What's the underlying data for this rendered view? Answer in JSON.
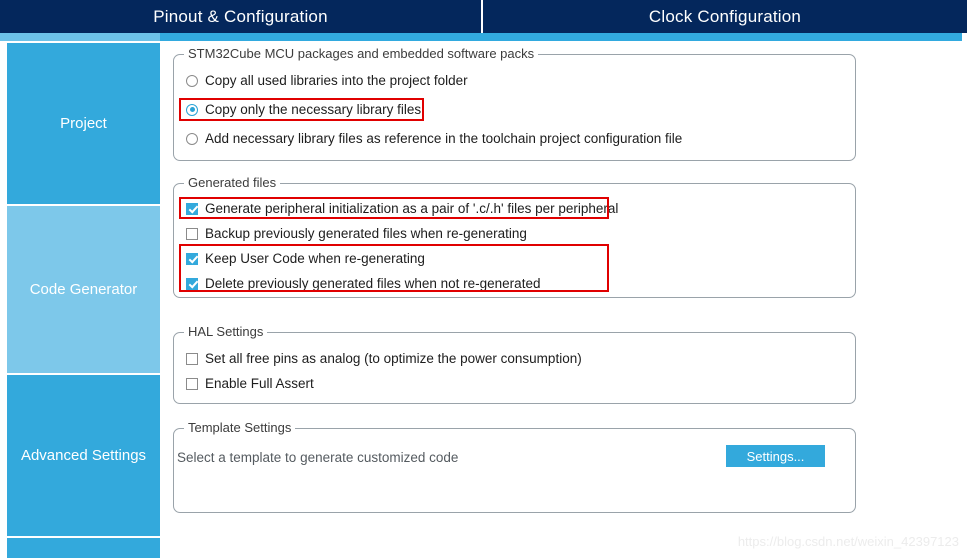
{
  "tabs": [
    {
      "id": "pinout",
      "label": "Pinout & Configuration"
    },
    {
      "id": "clock",
      "label": "Clock Configuration"
    }
  ],
  "sidebar": {
    "items": [
      {
        "id": "project",
        "label": "Project",
        "selected": false
      },
      {
        "id": "code-generator",
        "label": "Code Generator",
        "selected": true
      },
      {
        "id": "advanced-settings",
        "label": "Advanced Settings",
        "selected": false
      }
    ]
  },
  "groups": {
    "packages": {
      "legend": "STM32Cube MCU packages and embedded software packs",
      "options": [
        {
          "id": "copy-all",
          "label": "Copy all used libraries into the project folder",
          "checked": false
        },
        {
          "id": "copy-necessary",
          "label": "Copy only the necessary library files",
          "checked": true,
          "highlighted": true
        },
        {
          "id": "add-reference",
          "label": "Add necessary library files as reference in the toolchain project configuration file",
          "checked": false
        }
      ]
    },
    "generated_files": {
      "legend": "Generated files",
      "options": [
        {
          "id": "generate-peripheral-init",
          "label": "Generate peripheral initialization as a pair of '.c/.h' files per peripheral",
          "checked": true,
          "highlighted": true
        },
        {
          "id": "backup-previous",
          "label": "Backup previously generated files when re-generating",
          "checked": false,
          "highlighted": false
        },
        {
          "id": "keep-user-code",
          "label": "Keep User Code when re-generating",
          "checked": true,
          "highlighted": true
        },
        {
          "id": "delete-previous",
          "label": "Delete previously generated files when not re-generated",
          "checked": true,
          "highlighted": true
        }
      ]
    },
    "hal_settings": {
      "legend": "HAL Settings",
      "options": [
        {
          "id": "set-free-pins-analog",
          "label": "Set all free pins as analog (to optimize the power consumption)",
          "checked": false
        },
        {
          "id": "enable-full-assert",
          "label": "Enable Full Assert",
          "checked": false
        }
      ]
    },
    "template_settings": {
      "legend": "Template Settings",
      "description": "Select a template to generate customized code",
      "button_label": "Settings..."
    }
  },
  "watermark": "https://blog.csdn.net/weixin_42397123",
  "colors": {
    "tabbar_bg": "#04275c",
    "accent": "#33a9dc",
    "accent_light": "#7dc8ea",
    "annotation": "#e00000",
    "checkbox_checked": "#33a9dc",
    "radio_checked": "#2aa3d6"
  }
}
